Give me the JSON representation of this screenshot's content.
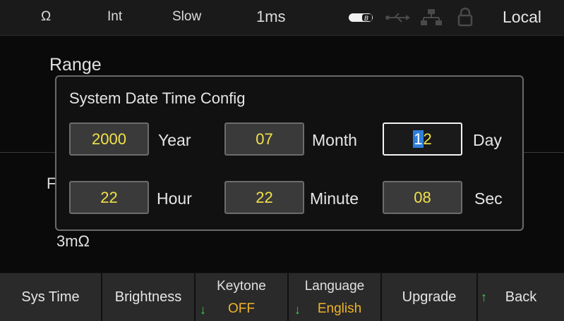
{
  "status_bar": {
    "mode": "Ω",
    "integration": "Int",
    "speed": "Slow",
    "aperture": "1ms",
    "location": "Local",
    "icons": [
      "battery-icon",
      "usb-icon",
      "network-icon",
      "lock-icon"
    ]
  },
  "background": {
    "range_label": "Range",
    "range_value": "3mΩ",
    "p_label": "F"
  },
  "dialog": {
    "title": "System Date Time Config",
    "year": {
      "value": "2000",
      "label": "Year"
    },
    "month": {
      "value": "07",
      "label": "Month"
    },
    "day": {
      "value": "12",
      "label": "Day",
      "cursor_char": "1",
      "rest": "2"
    },
    "hour": {
      "value": "22",
      "label": "Hour"
    },
    "minute": {
      "value": "22",
      "label": "Minute"
    },
    "sec": {
      "value": "08",
      "label": "Sec"
    }
  },
  "softkeys": {
    "sys_time": "Sys Time",
    "brightness": "Brightness",
    "keytone_label": "Keytone",
    "keytone_value": "OFF",
    "language_label": "Language",
    "language_value": "English",
    "upgrade": "Upgrade",
    "back": "Back"
  },
  "colors": {
    "field_value": "#f2e14a",
    "softkey_value": "#f0b428",
    "arrow": "#3ad04a",
    "cursor": "#2f7fd8"
  }
}
